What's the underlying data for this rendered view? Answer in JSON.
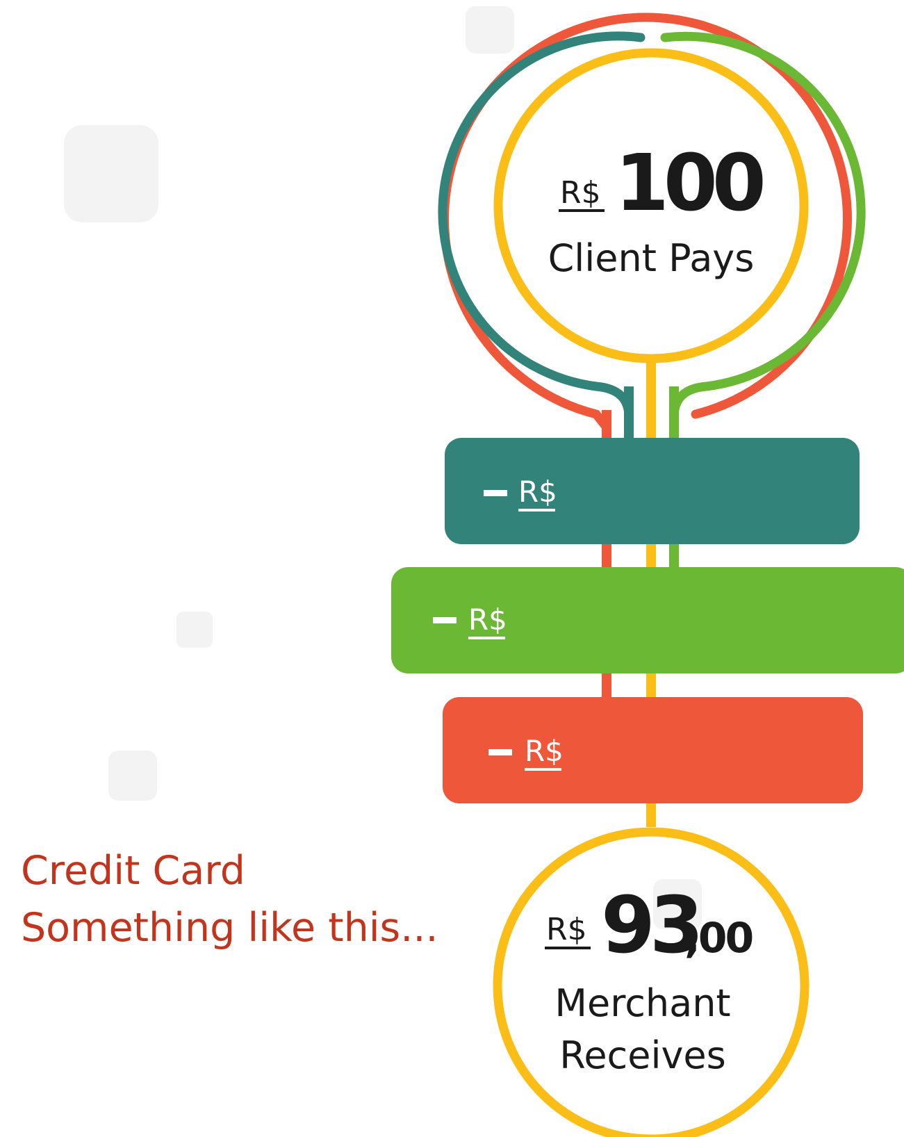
{
  "colors": {
    "teal": "#32837a",
    "green": "#6ab833",
    "red": "#ef573a",
    "yellow": "#fbbe17",
    "caption": "#c2351c"
  },
  "top_circle": {
    "currency": "R$",
    "amount": "100",
    "label": "Client Pays"
  },
  "deductions": [
    {
      "minus": "−",
      "currency": "R$",
      "color": "teal"
    },
    {
      "minus": "−",
      "currency": "R$",
      "color": "green"
    },
    {
      "minus": "−",
      "currency": "R$",
      "color": "red"
    }
  ],
  "bottom_circle": {
    "currency": "R$",
    "amount": "93",
    "cents": ",00",
    "label_line1": "Merchant",
    "label_line2": "Receives"
  },
  "caption": {
    "line1": "Credit Card",
    "line2": "Something like this..."
  }
}
